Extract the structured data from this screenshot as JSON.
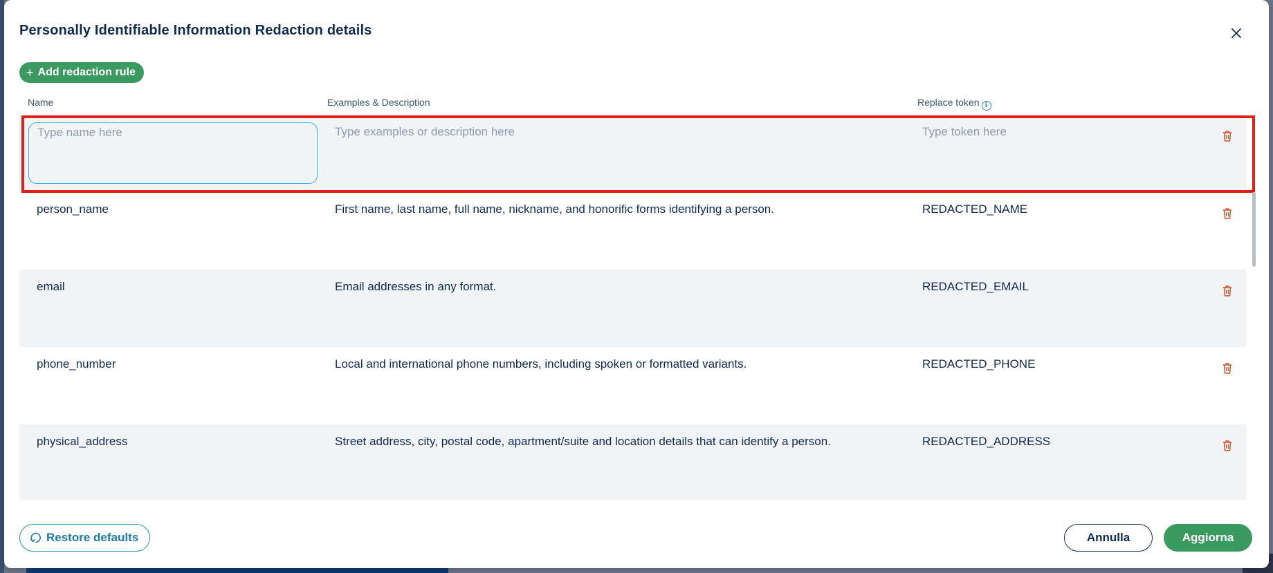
{
  "modal": {
    "title": "Personally Identifiable Information Redaction details",
    "add_button_label": "Add redaction rule",
    "columns": {
      "name": "Name",
      "description": "Examples & Description",
      "token": "Replace token"
    },
    "new_row": {
      "name_placeholder": "Type name here",
      "description_placeholder": "Type examples or description here",
      "token_placeholder": "Type token here"
    },
    "rules": [
      {
        "name": "person_name",
        "description": "First name, last name, full name, nickname, and honorific forms identifying a person.",
        "token": "REDACTED_NAME"
      },
      {
        "name": "email",
        "description": "Email addresses in any format.",
        "token": "REDACTED_EMAIL"
      },
      {
        "name": "phone_number",
        "description": "Local and international phone numbers, including spoken or formatted variants.",
        "token": "REDACTED_PHONE"
      },
      {
        "name": "physical_address",
        "description": "Street address, city, postal code, apartment/suite and location details that can identify a person.",
        "token": "REDACTED_ADDRESS"
      }
    ],
    "footer": {
      "restore_label": "Restore defaults",
      "cancel_label": "Annulla",
      "update_label": "Aggiorna"
    }
  },
  "icons": {
    "close": "close-icon",
    "plus": "plus-icon",
    "info": "info-icon",
    "trash": "trash-icon",
    "restore": "restore-icon"
  },
  "colors": {
    "primary_green": "#3a9a5f",
    "navy": "#0f2a52",
    "danger": "#d0502a",
    "highlight_red": "#e0201c",
    "row_shade": "#f3f4f6"
  }
}
